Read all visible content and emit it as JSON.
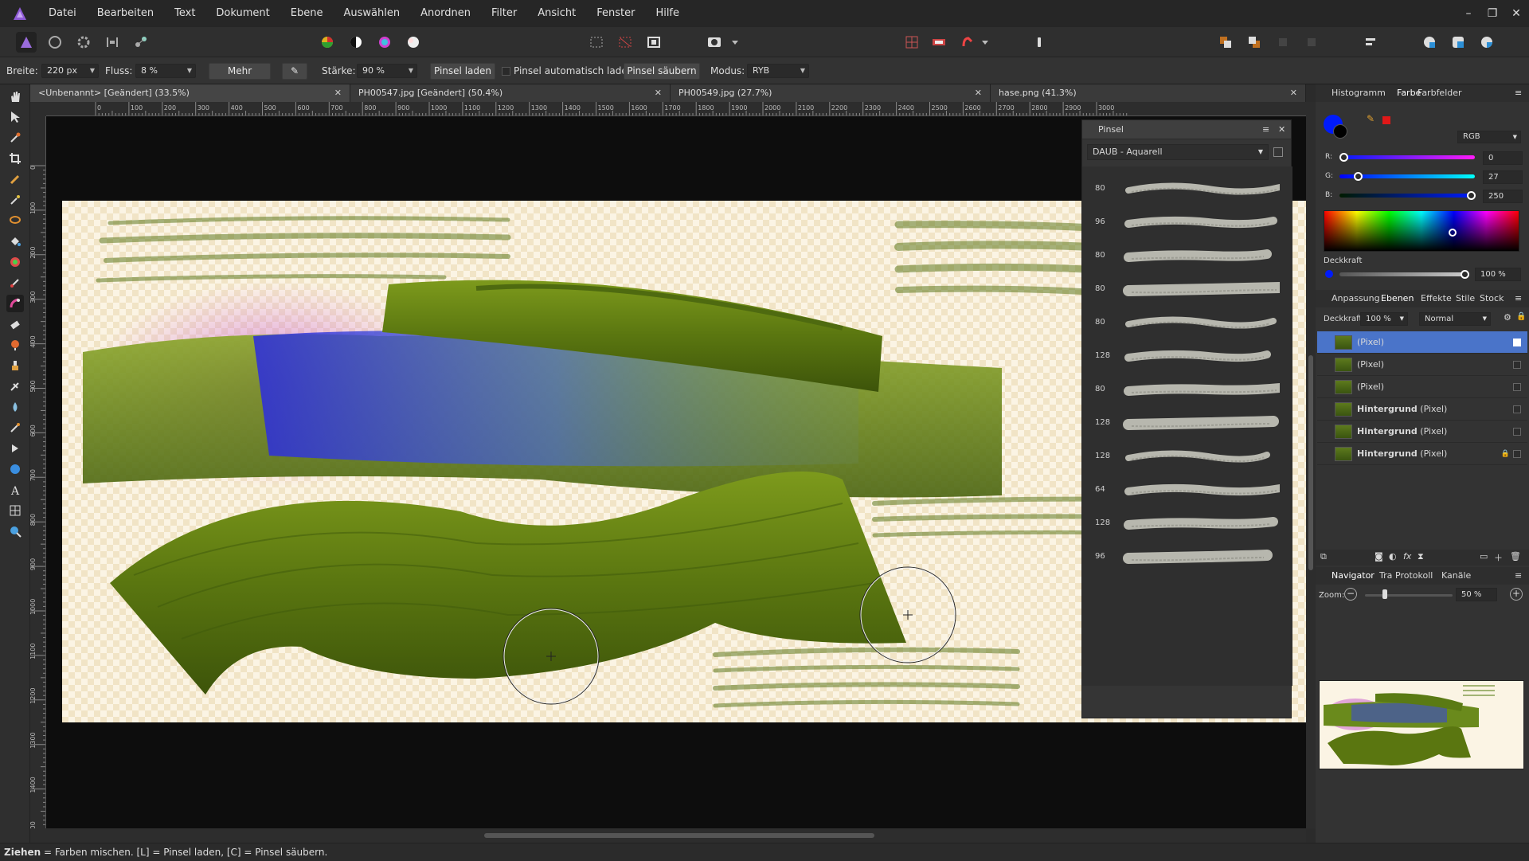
{
  "menu": {
    "items": [
      "Datei",
      "Bearbeiten",
      "Text",
      "Dokument",
      "Ebene",
      "Auswählen",
      "Anordnen",
      "Filter",
      "Ansicht",
      "Fenster",
      "Hilfe"
    ]
  },
  "context": {
    "width_label": "Breite:",
    "width_value": "220 px",
    "flow_label": "Fluss:",
    "flow_value": "8 %",
    "more_button": "Mehr",
    "strength_label": "Stärke:",
    "strength_value": "90 %",
    "load_brush": "Pinsel laden",
    "auto_load": "Pinsel automatisch laden",
    "clean_brush": "Pinsel säubern",
    "mode_label": "Modus:",
    "mode_value": "RYB"
  },
  "tabs": [
    {
      "label": "<Unbenannt> [Geändert] (33.5%)"
    },
    {
      "label": "PH00547.jpg [Geändert] (50.4%)"
    },
    {
      "label": "PH00549.jpg (27.7%)"
    },
    {
      "label": "hase.png (41.3%)"
    }
  ],
  "rulers": {
    "h": [
      "0",
      "100",
      "200",
      "300",
      "400",
      "500",
      "600",
      "700",
      "800",
      "900",
      "1000",
      "1100",
      "1200",
      "1300",
      "1400",
      "1500",
      "1600",
      "1700",
      "1800",
      "1900",
      "2000",
      "2100",
      "2200",
      "2300",
      "2400",
      "2500",
      "2600",
      "2700",
      "2800",
      "2900",
      "3000"
    ],
    "v": [
      "0",
      "100",
      "200",
      "300",
      "400",
      "500",
      "600",
      "700",
      "800",
      "900",
      "1000",
      "1100",
      "1200",
      "1300",
      "1400",
      "1500"
    ]
  },
  "brush_panel": {
    "title": "Pinsel",
    "category": "DAUB - Aquarell",
    "sizes": [
      "80",
      "96",
      "80",
      "80",
      "80",
      "128",
      "80",
      "128",
      "128",
      "64",
      "128",
      "96"
    ]
  },
  "color_panel": {
    "tabs": [
      "Histogramm",
      "Farbe",
      "Farbfelder"
    ],
    "model": "RGB",
    "r_label": "R:",
    "r_value": "0",
    "g_label": "G:",
    "g_value": "27",
    "b_label": "B:",
    "b_value": "250",
    "opacity_label": "Deckkraft",
    "opacity_value": "100 %",
    "current_color": "#001bfa"
  },
  "layers_panel": {
    "tabs": [
      "Anpassung",
      "Ebenen",
      "Effekte",
      "Stile",
      "Stock"
    ],
    "opacity_label": "Deckkraft:",
    "opacity_value": "100 %",
    "blend_mode": "Normal",
    "layers": [
      {
        "bold": "",
        "name": "(Pixel)"
      },
      {
        "bold": "",
        "name": "(Pixel)"
      },
      {
        "bold": "",
        "name": "(Pixel)"
      },
      {
        "bold": "Hintergrund",
        "name": " (Pixel)"
      },
      {
        "bold": "Hintergrund",
        "name": " (Pixel)"
      },
      {
        "bold": "Hintergrund",
        "name": " (Pixel)"
      }
    ]
  },
  "navigator": {
    "tabs": [
      "Navigator",
      "Tra",
      "Protokoll",
      "Kanäle"
    ],
    "zoom_label": "Zoom:",
    "zoom_value": "50 %"
  },
  "status": {
    "bold": "Ziehen",
    "text": " = Farben mischen. [L] = Pinsel laden, [C] = Pinsel säubern."
  }
}
